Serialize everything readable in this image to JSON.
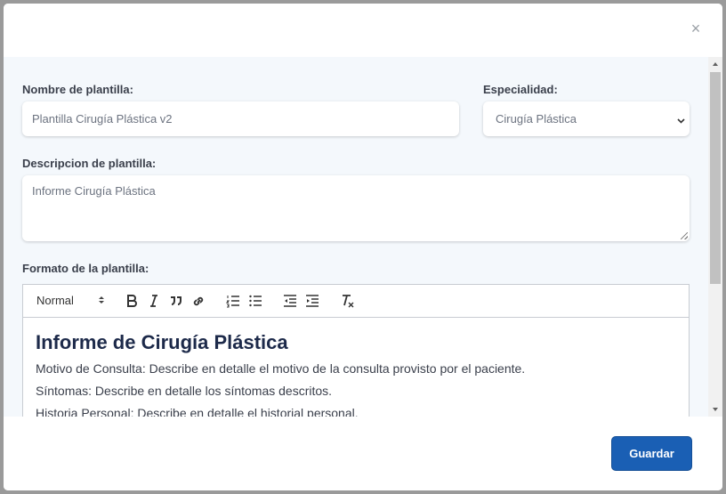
{
  "close_label": "×",
  "form": {
    "template_name_label": "Nombre de plantilla:",
    "template_name_value": "Plantilla Cirugía Plástica v2",
    "specialty_label": "Especialidad:",
    "specialty_value": "Cirugía Plástica",
    "description_label": "Descripcion de plantilla:",
    "description_value": "Informe Cirugía Plástica",
    "format_label": "Formato de la plantilla:"
  },
  "editor": {
    "heading_select": "Normal",
    "toolbar_icons": [
      "bold-icon",
      "italic-icon",
      "quote-icon",
      "link-icon",
      "ordered-list-icon",
      "bullet-list-icon",
      "outdent-icon",
      "indent-icon",
      "clear-format-icon"
    ],
    "title": "Informe de Cirugía Plástica",
    "lines": [
      "Motivo de Consulta: Describe en detalle el motivo de la consulta provisto por el paciente.",
      "Síntomas: Describe en detalle los síntomas descritos.",
      "Historia Personal: Describe en detalle el historial personal."
    ]
  },
  "footer": {
    "save_label": "Guardar"
  },
  "colors": {
    "primary": "#1a5fb4",
    "body_bg": "#f4f8fc",
    "title_text": "#1d2a4a"
  }
}
